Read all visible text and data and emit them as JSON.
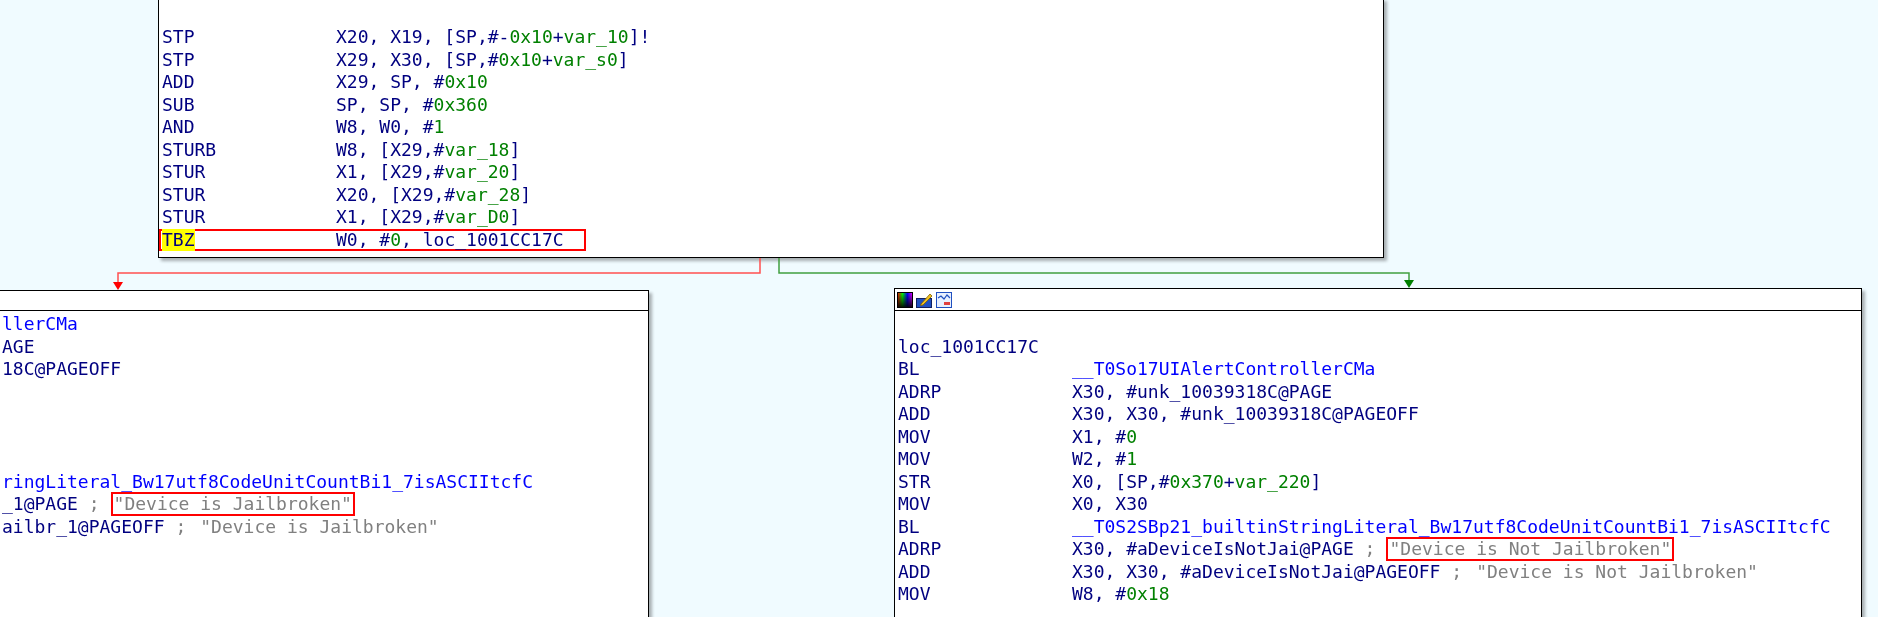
{
  "top_block": {
    "lines": [
      {
        "mnemonic": "STP",
        "highlighted": false,
        "boxed": false,
        "operands": [
          {
            "t": "X20, X19, [SP,#-",
            "kind": "reg"
          },
          {
            "t": "0x10",
            "kind": "num"
          },
          {
            "t": "+",
            "kind": "reg"
          },
          {
            "t": "var_10",
            "kind": "num"
          },
          {
            "t": "]!",
            "kind": "reg"
          }
        ]
      },
      {
        "mnemonic": "STP",
        "highlighted": false,
        "boxed": false,
        "operands": [
          {
            "t": "X29, X30, [SP,#",
            "kind": "reg"
          },
          {
            "t": "0x10",
            "kind": "num"
          },
          {
            "t": "+",
            "kind": "reg"
          },
          {
            "t": "var_s0",
            "kind": "num"
          },
          {
            "t": "]",
            "kind": "reg"
          }
        ]
      },
      {
        "mnemonic": "ADD",
        "highlighted": false,
        "boxed": false,
        "operands": [
          {
            "t": "X29, SP, #",
            "kind": "reg"
          },
          {
            "t": "0x10",
            "kind": "num"
          }
        ]
      },
      {
        "mnemonic": "SUB",
        "highlighted": false,
        "boxed": false,
        "operands": [
          {
            "t": "SP, SP, #",
            "kind": "reg"
          },
          {
            "t": "0x360",
            "kind": "num"
          }
        ]
      },
      {
        "mnemonic": "AND",
        "highlighted": false,
        "boxed": false,
        "operands": [
          {
            "t": "W8, W0, #",
            "kind": "reg"
          },
          {
            "t": "1",
            "kind": "num"
          }
        ]
      },
      {
        "mnemonic": "STURB",
        "highlighted": false,
        "boxed": false,
        "operands": [
          {
            "t": "W8, [X29,#",
            "kind": "reg"
          },
          {
            "t": "var_18",
            "kind": "num"
          },
          {
            "t": "]",
            "kind": "reg"
          }
        ]
      },
      {
        "mnemonic": "STUR",
        "highlighted": false,
        "boxed": false,
        "operands": [
          {
            "t": "X1, [X29,#",
            "kind": "reg"
          },
          {
            "t": "var_20",
            "kind": "num"
          },
          {
            "t": "]",
            "kind": "reg"
          }
        ]
      },
      {
        "mnemonic": "STUR",
        "highlighted": false,
        "boxed": false,
        "operands": [
          {
            "t": "X20, [X29,#",
            "kind": "reg"
          },
          {
            "t": "var_28",
            "kind": "num"
          },
          {
            "t": "]",
            "kind": "reg"
          }
        ]
      },
      {
        "mnemonic": "STUR",
        "highlighted": false,
        "boxed": false,
        "operands": [
          {
            "t": "X1, [X29,#",
            "kind": "reg"
          },
          {
            "t": "var_D0",
            "kind": "num"
          },
          {
            "t": "]",
            "kind": "reg"
          }
        ]
      },
      {
        "mnemonic": "TBZ",
        "highlighted": true,
        "boxed": true,
        "operands": [
          {
            "t": "W0, #",
            "kind": "reg"
          },
          {
            "t": "0",
            "kind": "num"
          },
          {
            "t": ", loc_1001CC17C",
            "kind": "reg"
          }
        ]
      }
    ]
  },
  "left_block": {
    "line_groups": [
      [
        {
          "operands": [
            {
              "t": "llerCMa",
              "kind": "name"
            }
          ]
        },
        {
          "operands": [
            {
              "t": "AGE",
              "kind": "reg"
            }
          ]
        },
        {
          "operands": [
            {
              "t": "18C@PAGEOFF",
              "kind": "reg"
            }
          ]
        }
      ],
      [
        {
          "operands": [
            {
              "t": "ringLiteral_Bw17utf8CodeUnitCountBi1_7isASCIItcfC",
              "kind": "name"
            }
          ]
        },
        {
          "operands": [
            {
              "t": "_1@PAGE",
              "kind": "reg"
            },
            {
              "t": " ;",
              "kind": "sep"
            }
          ],
          "comment": {
            "text": "\"Device is Jailbroken\"",
            "boxed": true
          }
        },
        {
          "operands": [
            {
              "t": "ailbr_1@PAGEOFF",
              "kind": "reg"
            },
            {
              "t": " ;",
              "kind": "sep"
            }
          ],
          "comment": {
            "text": "\"Device is Jailbroken\"",
            "boxed": false
          }
        }
      ]
    ]
  },
  "right_block": {
    "label": "loc_1001CC17C",
    "lines": [
      {
        "mnemonic": "BL",
        "operands": [
          {
            "t": "__T0So17UIAlertControllerCMa",
            "kind": "name"
          }
        ]
      },
      {
        "mnemonic": "ADRP",
        "operands": [
          {
            "t": "X30, #unk_10039318C@PAGE",
            "kind": "reg"
          }
        ]
      },
      {
        "mnemonic": "ADD",
        "operands": [
          {
            "t": "X30, X30, #unk_10039318C@PAGEOFF",
            "kind": "reg"
          }
        ]
      },
      {
        "mnemonic": "MOV",
        "operands": [
          {
            "t": "X1, #",
            "kind": "reg"
          },
          {
            "t": "0",
            "kind": "num"
          }
        ]
      },
      {
        "mnemonic": "MOV",
        "operands": [
          {
            "t": "W2, #",
            "kind": "reg"
          },
          {
            "t": "1",
            "kind": "num"
          }
        ]
      },
      {
        "mnemonic": "STR",
        "operands": [
          {
            "t": "X0, [SP,#",
            "kind": "reg"
          },
          {
            "t": "0x370",
            "kind": "num"
          },
          {
            "t": "+",
            "kind": "reg"
          },
          {
            "t": "var_220",
            "kind": "num"
          },
          {
            "t": "]",
            "kind": "reg"
          }
        ]
      },
      {
        "mnemonic": "MOV",
        "operands": [
          {
            "t": "X0, X30",
            "kind": "reg"
          }
        ]
      },
      {
        "mnemonic": "BL",
        "operands": [
          {
            "t": "__T0S2SBp21_builtinStringLiteral_Bw17utf8CodeUnitCountBi1_7isASCIItcfC",
            "kind": "name"
          }
        ]
      },
      {
        "mnemonic": "ADRP",
        "operands": [
          {
            "t": "X30, #aDeviceIsNotJai@PAGE",
            "kind": "reg"
          },
          {
            "t": " ;",
            "kind": "sep"
          }
        ],
        "comment": {
          "text": "\"Device is Not Jailbroken\"",
          "boxed": true
        }
      },
      {
        "mnemonic": "ADD",
        "operands": [
          {
            "t": "X30, X30, #aDeviceIsNotJai@PAGEOFF",
            "kind": "reg"
          },
          {
            "t": " ;",
            "kind": "sep"
          }
        ],
        "comment": {
          "text": "\"Device is Not Jailbroken\"",
          "boxed": false
        }
      },
      {
        "mnemonic": "MOV",
        "operands": [
          {
            "t": "W8, #",
            "kind": "reg"
          },
          {
            "t": "0x18",
            "kind": "num"
          }
        ]
      }
    ]
  }
}
